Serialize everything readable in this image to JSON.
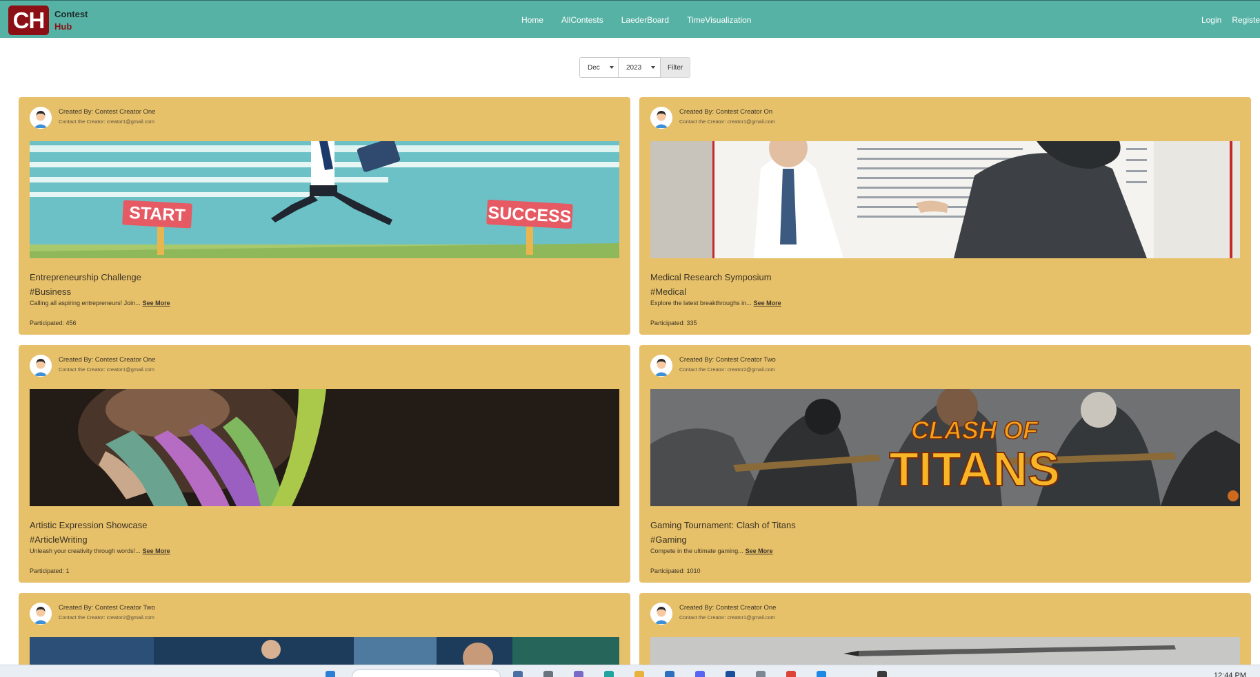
{
  "brand": {
    "logo": "CH",
    "line1": "Contest",
    "line2": "Hub"
  },
  "nav": {
    "links": [
      "Home",
      "AllContests",
      "LaederBoard",
      "TimeVisualization"
    ]
  },
  "auth": {
    "login": "Login",
    "register": "Registe"
  },
  "filter": {
    "month": "Dec",
    "year": "2023",
    "button": "Filter"
  },
  "cards": [
    {
      "creator": "Created By: Contest Creator One",
      "contact": "Contact the Creator: creator1@gmail.com",
      "title": "Entrepreneurship Challenge",
      "tag": "#Business",
      "desc": "Calling all aspiring entrepreneurs! Join...",
      "see_more": "See More",
      "participated": "Participated: 456",
      "banner": {
        "label1": "START",
        "label2": "SUCCESS"
      }
    },
    {
      "creator": "Created By: Contest Creator On",
      "contact": "Contact the Creator: creator1@gmail.com",
      "title": "Medical Research Symposium",
      "tag": "#Medical",
      "desc": "Explore the latest breakthroughs in...",
      "see_more": "See More",
      "participated": "Participated: 335"
    },
    {
      "creator": "Created By: Contest Creator One",
      "contact": "Contact the Creator: creator1@gmail.com",
      "title": "Artistic Expression Showcase",
      "tag": "#ArticleWriting",
      "desc": "Unleash your creativity through words!...",
      "see_more": "See More",
      "participated": "Participated: 1"
    },
    {
      "creator": "Created By: Contest Creator Two",
      "contact": "Contact the Creator: creator2@gmail.com",
      "title": "Gaming Tournament: Clash of Titans",
      "tag": "#Gaming",
      "desc": "Compete in the ultimate gaming...",
      "see_more": "See More",
      "participated": "Participated: 1010",
      "banner": {
        "label1": "CLASH OF",
        "label2": "TITANS"
      }
    },
    {
      "creator": "Created By: Contest Creator Two",
      "contact": "Contact the Creator: creator2@gmail.com"
    },
    {
      "creator": "Created By: Contest Creator One",
      "contact": "Contact the Creator: creator1@gmail.com"
    }
  ],
  "taskbar": {
    "time": "12:44 PM"
  },
  "colors": {
    "navbar": "#56b2a5",
    "card": "#e7c06a",
    "logo": "#8b0f14"
  }
}
